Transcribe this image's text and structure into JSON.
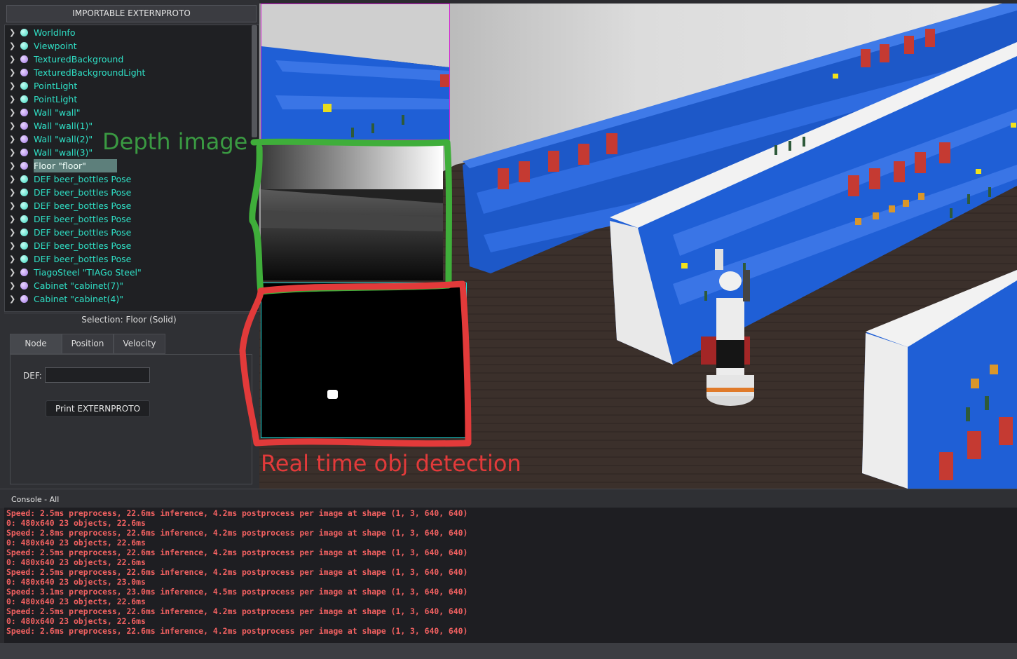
{
  "left_panel": {
    "externproto_button": "IMPORTABLE EXTERNPROTO",
    "tree_items": [
      {
        "label": "WorldInfo",
        "color": "cyan"
      },
      {
        "label": "Viewpoint",
        "color": "cyan"
      },
      {
        "label": "TexturedBackground",
        "color": "purple"
      },
      {
        "label": "TexturedBackgroundLight",
        "color": "purple"
      },
      {
        "label": "PointLight",
        "color": "cyan"
      },
      {
        "label": "PointLight",
        "color": "cyan"
      },
      {
        "label": "Wall \"wall\"",
        "color": "purple"
      },
      {
        "label": "Wall \"wall(1)\"",
        "color": "purple"
      },
      {
        "label": "Wall \"wall(2)\"",
        "color": "purple"
      },
      {
        "label": "Wall \"wall(3)\"",
        "color": "purple"
      },
      {
        "label": "Floor \"floor\"",
        "color": "purple",
        "selected": true
      },
      {
        "label": "DEF beer_bottles Pose",
        "color": "cyan"
      },
      {
        "label": "DEF beer_bottles Pose",
        "color": "cyan"
      },
      {
        "label": "DEF beer_bottles Pose",
        "color": "cyan"
      },
      {
        "label": "DEF beer_bottles Pose",
        "color": "cyan"
      },
      {
        "label": "DEF beer_bottles Pose",
        "color": "cyan"
      },
      {
        "label": "DEF beer_bottles Pose",
        "color": "cyan"
      },
      {
        "label": "DEF beer_bottles Pose",
        "color": "cyan"
      },
      {
        "label": "TiagoSteel \"TIAGo Steel\"",
        "color": "purple"
      },
      {
        "label": "Cabinet \"cabinet(7)\"",
        "color": "purple"
      },
      {
        "label": "Cabinet \"cabinet(4)\"",
        "color": "purple"
      }
    ],
    "selection_title": "Selection: Floor (Solid)",
    "tabs": [
      "Node",
      "Position",
      "Velocity"
    ],
    "def_label": "DEF:",
    "def_value": "",
    "print_button": "Print EXTERNPROTO"
  },
  "annotations": {
    "depth": "Depth image",
    "detection": "Real time obj detection"
  },
  "console": {
    "title": "Console - All",
    "lines": [
      "Speed: 2.5ms preprocess, 22.6ms inference, 4.2ms postprocess per image at shape (1, 3, 640, 640)",
      "0: 480x640 23 objects, 22.6ms",
      "Speed: 2.8ms preprocess, 22.6ms inference, 4.2ms postprocess per image at shape (1, 3, 640, 640)",
      "0: 480x640 23 objects, 22.6ms",
      "Speed: 2.5ms preprocess, 22.6ms inference, 4.2ms postprocess per image at shape (1, 3, 640, 640)",
      "0: 480x640 23 objects, 22.6ms",
      "Speed: 2.5ms preprocess, 22.6ms inference, 4.2ms postprocess per image at shape (1, 3, 640, 640)",
      "0: 480x640 23 objects, 23.0ms",
      "Speed: 3.1ms preprocess, 23.0ms inference, 4.5ms postprocess per image at shape (1, 3, 640, 640)",
      "0: 480x640 23 objects, 22.6ms",
      "Speed: 2.5ms preprocess, 22.6ms inference, 4.2ms postprocess per image at shape (1, 3, 640, 640)",
      "0: 480x640 23 objects, 22.6ms",
      "Speed: 2.6ms preprocess, 22.6ms inference, 4.2ms postprocess per image at shape (1, 3, 640, 640)"
    ]
  },
  "colors": {
    "console_text": "#f26161",
    "tree_text": "#2fe0c6",
    "depth_annotation": "#3a9a42",
    "detection_annotation": "#e23a3a",
    "shelf_blue": "#1f5fd6"
  }
}
